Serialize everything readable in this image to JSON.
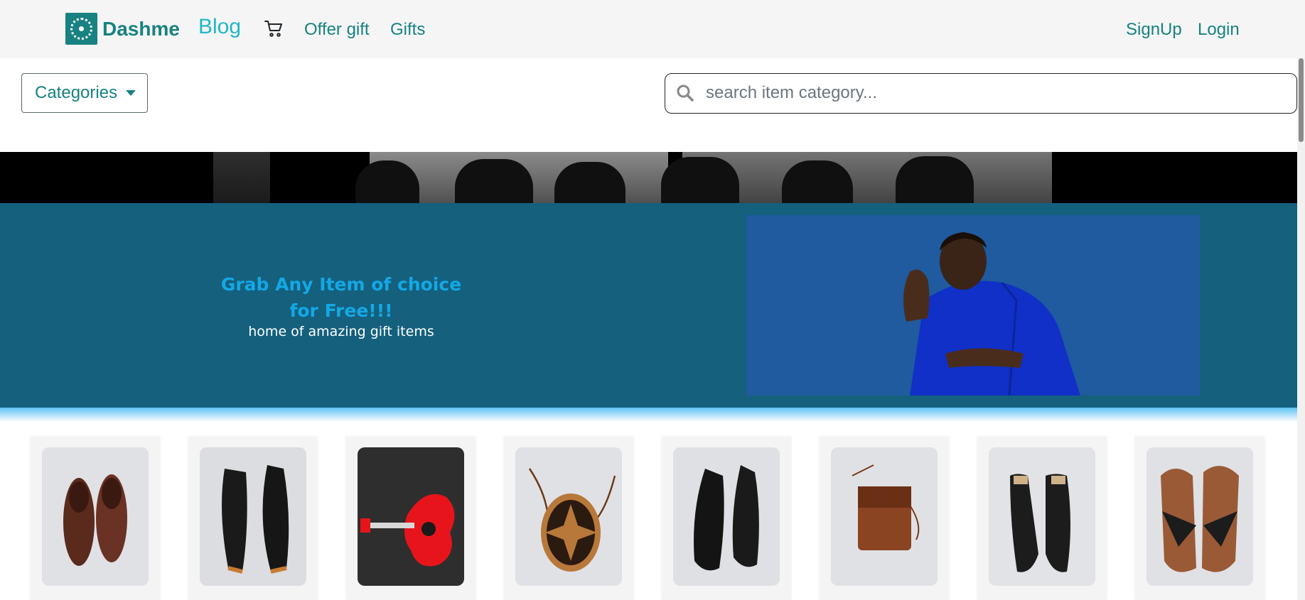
{
  "nav": {
    "brand": "Dashme",
    "blog": "Blog",
    "offer_gift": "Offer gift",
    "gifts": "Gifts",
    "signup": "SignUp",
    "login": "Login",
    "cart_icon": "cart-icon",
    "logo_icon": "dashme-logo-icon"
  },
  "toolbar": {
    "categories_label": "Categories",
    "search_placeholder": "search item category...",
    "search_value": ""
  },
  "hero": {
    "title": "Grab Any Item of choice for Free!!!",
    "subtitle": "home of amazing gift items"
  },
  "products": [
    {
      "name": "brown-loafers"
    },
    {
      "name": "black-platform-shoes"
    },
    {
      "name": "red-guitar"
    },
    {
      "name": "round-rattan-bag"
    },
    {
      "name": "black-sneakers"
    },
    {
      "name": "brown-croc-bag"
    },
    {
      "name": "black-heeled-sandals"
    },
    {
      "name": "brown-leather-slippers"
    }
  ],
  "colors": {
    "brand": "#178281",
    "blog": "#22b8c4",
    "hero_bg": "#14607d",
    "hero_title": "#13a8e6",
    "navbar_bg": "#f5f5f5"
  }
}
